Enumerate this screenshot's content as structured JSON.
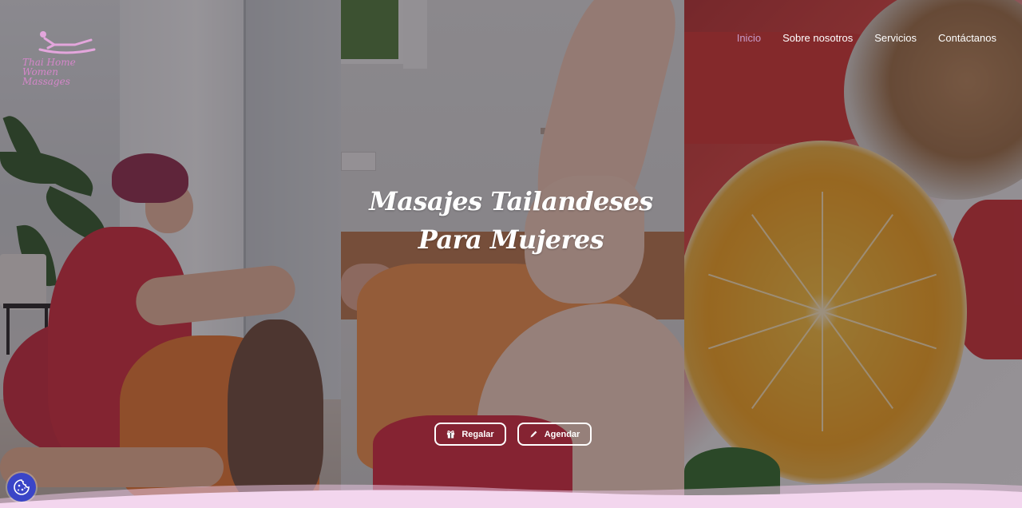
{
  "brand": {
    "logo_line1": "Thai Home Women",
    "logo_line2": "Massages"
  },
  "nav": {
    "items": [
      {
        "label": "Inicio",
        "active": true
      },
      {
        "label": "Sobre nosotros",
        "active": false
      },
      {
        "label": "Servicios",
        "active": false
      },
      {
        "label": "Contáctanos",
        "active": false
      }
    ]
  },
  "hero": {
    "title_line1": "Masajes Tailandeses",
    "title_line2": "Para Mujeres",
    "buttons": {
      "gift_label": "Regalar",
      "book_label": "Agendar"
    }
  },
  "icons": {
    "logo": "reclining-figure-icon",
    "gift": "gift-icon",
    "book": "pencil-icon",
    "cookie": "cookie-icon"
  },
  "colors": {
    "nav_active": "#c79bc9",
    "logo": "#d486c9",
    "cookie_button": "#3a45c7",
    "wave": "#f3d6ee"
  }
}
